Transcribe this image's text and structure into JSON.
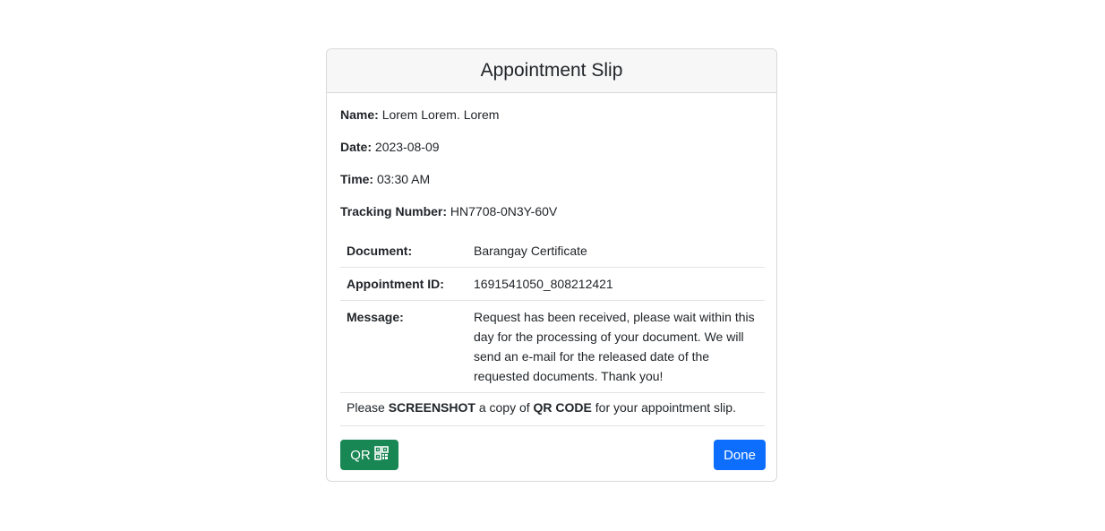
{
  "card": {
    "title": "Appointment Slip"
  },
  "info": {
    "name_label": "Name:",
    "name_value": "Lorem Lorem. Lorem",
    "date_label": "Date:",
    "date_value": "2023-08-09",
    "time_label": "Time:",
    "time_value": "03:30 AM",
    "tracking_label": "Tracking Number:",
    "tracking_value": "HN7708-0N3Y-60V"
  },
  "details": [
    {
      "label": "Document:",
      "value": "Barangay Certificate"
    },
    {
      "label": "Appointment ID:",
      "value": "1691541050_808212421"
    },
    {
      "label": "Message:",
      "value": "Request has been received, please wait within this day for the processing of your document. We will send an e-mail for the released date of the requested documents. Thank you!"
    }
  ],
  "note": {
    "part1": "Please ",
    "bold1": "SCREENSHOT",
    "part2": " a copy of ",
    "bold2": "QR CODE",
    "part3": " for your appointment slip."
  },
  "buttons": {
    "qr_label": "QR",
    "qr_icon": "qr-code-icon",
    "done_label": "Done"
  },
  "colors": {
    "qr_button": "#198754",
    "done_button": "#0d6efd",
    "header_bg": "#f7f7f7"
  }
}
